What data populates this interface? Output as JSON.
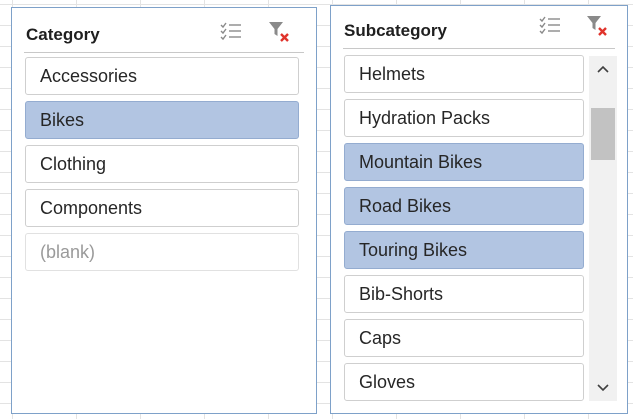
{
  "category_slicer": {
    "title": "Category",
    "items": [
      {
        "label": "Accessories",
        "selected": false
      },
      {
        "label": "Bikes",
        "selected": true
      },
      {
        "label": "Clothing",
        "selected": false
      },
      {
        "label": "Components",
        "selected": false
      },
      {
        "label": "(blank)",
        "selected": false
      }
    ],
    "multi_select_icon": "multi-select-icon",
    "clear_filter_icon": "clear-filter-icon"
  },
  "subcategory_slicer": {
    "title": "Subcategory",
    "items": [
      {
        "label": "Helmets",
        "selected": false
      },
      {
        "label": "Hydration Packs",
        "selected": false
      },
      {
        "label": "Mountain Bikes",
        "selected": true
      },
      {
        "label": "Road Bikes",
        "selected": true
      },
      {
        "label": "Touring Bikes",
        "selected": true
      },
      {
        "label": "Bib-Shorts",
        "selected": false
      },
      {
        "label": "Caps",
        "selected": false
      },
      {
        "label": "Gloves",
        "selected": false
      }
    ],
    "multi_select_icon": "multi-select-icon",
    "clear_filter_icon": "clear-filter-icon",
    "scroll_up_icon": "chevron-up-icon",
    "scroll_down_icon": "chevron-down-icon"
  },
  "colors": {
    "selected_fill": "#b2c5e2",
    "slicer_border": "#7ea1c9",
    "clear_filter_x": "#e0332b"
  }
}
